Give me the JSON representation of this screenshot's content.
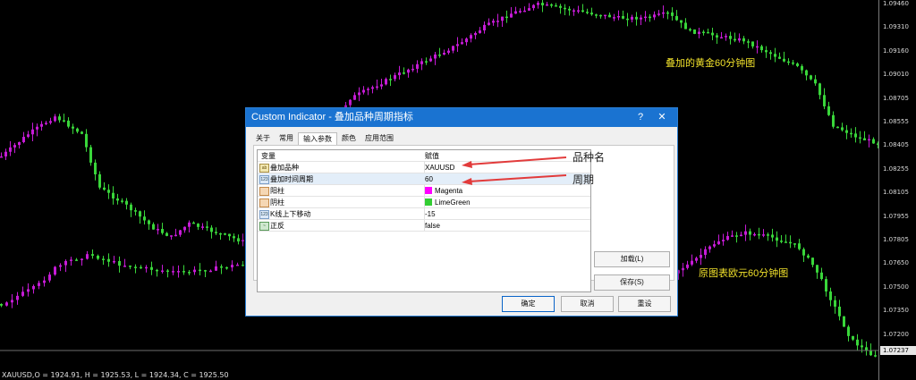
{
  "price_axis": {
    "labels": [
      "1.09460",
      "1.09310",
      "1.09160",
      "1.09010",
      "1.08705",
      "1.08555",
      "1.08405",
      "1.08255",
      "1.08105",
      "1.07955",
      "1.07805",
      "1.07650",
      "1.07500",
      "1.07350",
      "1.07200"
    ],
    "current": "1.07237"
  },
  "ohlc_text": "XAUUSD,O = 1924.91, H = 1925.53, L = 1924.34, C = 1925.50",
  "chart_notes": {
    "gold": "叠加的黄金60分钟图",
    "eur": "原图表欧元60分钟图"
  },
  "colors": {
    "bull": "#c61bd6",
    "bear": "#39d63a",
    "dialog_title": "#1a73d1"
  },
  "dialog": {
    "title": "Custom Indicator - 叠加品种周期指标",
    "help_icon": "?",
    "close_icon": "✕",
    "tabs": [
      "关于",
      "常用",
      "输入参数",
      "颜色",
      "应用范围"
    ],
    "active_tab": 2,
    "table": {
      "headers": [
        "变量",
        "赋值"
      ],
      "rows": [
        {
          "icon": "ab",
          "icon_text": "ab",
          "name": "叠加品种",
          "value": "XAUUSD",
          "color": ""
        },
        {
          "icon": "num",
          "icon_text": "123",
          "name": "叠加时间周期",
          "value": "60",
          "color": ""
        },
        {
          "icon": "col",
          "icon_text": "",
          "name": "阳柱",
          "value": "Magenta",
          "color": "#ff00ff"
        },
        {
          "icon": "col",
          "icon_text": "",
          "name": "阴柱",
          "value": "LimeGreen",
          "color": "#32cd32"
        },
        {
          "icon": "num",
          "icon_text": "123",
          "name": "K线上下移动",
          "value": "-15",
          "color": ""
        },
        {
          "icon": "bool",
          "icon_text": "~",
          "name": "正反",
          "value": "false",
          "color": ""
        }
      ]
    },
    "buttons": {
      "load": "加载(L)",
      "save": "保存(S)",
      "ok": "确定",
      "cancel": "取消",
      "reset": "重设"
    }
  },
  "annotations": {
    "symbol_name": "品种名",
    "period": "周期"
  }
}
